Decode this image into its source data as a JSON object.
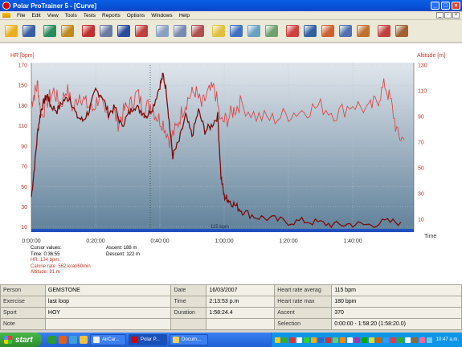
{
  "window": {
    "title": "Polar ProTrainer 5 - [Curve]",
    "minimize": "_",
    "maximize": "□",
    "close": "×"
  },
  "menu": [
    "File",
    "Edit",
    "View",
    "Tools",
    "Tests",
    "Reports",
    "Options",
    "Windows",
    "Help"
  ],
  "toolbar_icons": [
    "open-folder-icon",
    "save-icon",
    "add-exercise-icon",
    "add-note-icon",
    "chart-icon",
    "calendar-icon",
    "book-icon",
    "color-icon",
    "curve-icon",
    "zones-icon",
    "laps-icon",
    "search-icon",
    "download-icon",
    "sync-icon",
    "wave-icon",
    "graph1-icon",
    "graph2-icon",
    "graph3-icon",
    "graph4-icon",
    "graph5-icon",
    "report-icon",
    "users-icon"
  ],
  "chart": {
    "left_axis_title": "HR [bpm]",
    "right_axis_title": "Altitude [m]",
    "x_axis_title": "Time",
    "hr_ticks": [
      "170",
      "150",
      "130",
      "110",
      "90",
      "70",
      "50",
      "30",
      "10"
    ],
    "alt_ticks": [
      "130",
      "110",
      "90",
      "70",
      "50",
      "30",
      "10"
    ],
    "time_ticks": [
      "0:00:00",
      "0:20:00",
      "0:40:00",
      "1:00:00",
      "1:20:00",
      "1:40:00"
    ],
    "hr_marker_label": "115 bpm",
    "colors": {
      "hr": "#7a0c0c",
      "altitude": "#d94a4a",
      "bg_top": "#dde3ea",
      "bg_bottom": "#6a8aa4",
      "hr_marker": "#2050c0"
    }
  },
  "chart_data": {
    "type": "line",
    "x_unit": "time",
    "x_ticks": [
      "0:00:00",
      "0:20:00",
      "0:40:00",
      "1:00:00",
      "1:20:00",
      "1:40:00"
    ],
    "ylabel": "HR [bpm]",
    "ylabel_right": "Altitude [m]",
    "xlabel": "Time",
    "ylim": [
      5,
      170
    ],
    "ylim_right": [
      0,
      130
    ],
    "grid": true,
    "cursor_time": "0:36:55",
    "series": [
      {
        "axis": "left",
        "x_minutes": [
          0,
          1,
          2,
          3,
          4,
          5,
          6,
          8,
          10,
          12,
          14,
          16,
          18,
          20,
          22,
          24,
          26,
          28,
          30,
          32,
          34,
          36,
          38,
          40,
          41,
          42,
          43,
          44,
          46,
          48,
          50,
          52,
          54,
          56,
          58,
          59,
          60,
          61,
          62,
          64,
          66,
          70,
          75,
          80,
          85,
          90,
          95,
          100,
          105,
          110,
          115
        ],
        "values": [
          40,
          70,
          105,
          125,
          135,
          140,
          130,
          125,
          135,
          138,
          120,
          115,
          125,
          145,
          140,
          122,
          128,
          110,
          120,
          130,
          125,
          120,
          130,
          150,
          160,
          145,
          110,
          80,
          95,
          120,
          100,
          125,
          105,
          110,
          120,
          60,
          40,
          38,
          35,
          30,
          25,
          20,
          18,
          15,
          16,
          14,
          12,
          13,
          12,
          15,
          15
        ]
      },
      {
        "axis": "right",
        "x_minutes": [
          0,
          1,
          2,
          3,
          5,
          7,
          9,
          11,
          13,
          15,
          17,
          19,
          21,
          23,
          25,
          27,
          29,
          31,
          33,
          35,
          37,
          39,
          41,
          43,
          45,
          47,
          49,
          51,
          53,
          55,
          57,
          59,
          61,
          63,
          65,
          70,
          75,
          80,
          85,
          90,
          95,
          100,
          105,
          108,
          110,
          112,
          114,
          116
        ],
        "values": [
          100,
          108,
          115,
          90,
          102,
          110,
          98,
          112,
          95,
          108,
          100,
          95,
          105,
          90,
          98,
          85,
          95,
          100,
          108,
          95,
          100,
          90,
          85,
          72,
          80,
          95,
          105,
          110,
          98,
          108,
          112,
          85,
          88,
          95,
          100,
          90,
          88,
          92,
          95,
          98,
          92,
          100,
          95,
          104,
          115,
          100,
          75,
          72
        ]
      }
    ],
    "hr_limit": 115
  },
  "cursor_values": {
    "heading": "Cursor values:",
    "time": "Time: 0:36:55",
    "hr": "HR: 134 bpm",
    "calorie": "Calorie rate: 562 kcal/60min",
    "altitude": "Altitude: 91 m",
    "ascent": "Ascent: 188 m",
    "descent": "Descent: 122 m"
  },
  "info_table": {
    "rows": [
      [
        {
          "l": "Person"
        },
        {
          "v": "GEMSTONE"
        },
        {
          "l": "Date"
        },
        {
          "v": "16/03/2007"
        },
        {
          "l": "Heart rate averag"
        },
        {
          "v": "115 bpm"
        }
      ],
      [
        {
          "l": "Exercise"
        },
        {
          "v": "last loop"
        },
        {
          "l": "Time"
        },
        {
          "v": "2:13:53 p.m"
        },
        {
          "l": "Heart rate max"
        },
        {
          "v": "180 bpm"
        }
      ],
      [
        {
          "l": "Sport"
        },
        {
          "v": "HOY"
        },
        {
          "l": "Duration"
        },
        {
          "v": "1:58:24.4"
        },
        {
          "l": "Ascent"
        },
        {
          "v": "370"
        }
      ],
      [
        {
          "l": "Note"
        },
        {
          "v": ""
        },
        {
          "l": ""
        },
        {
          "v": ""
        },
        {
          "l": "Selection"
        },
        {
          "v": "0:00:00 - 1:58:20 (1:58:20.0)"
        }
      ]
    ]
  },
  "taskbar": {
    "start": "start",
    "tasks": [
      "AirCar...",
      "Polar P...",
      "Docum..."
    ],
    "clock": "10:47 a.m."
  }
}
